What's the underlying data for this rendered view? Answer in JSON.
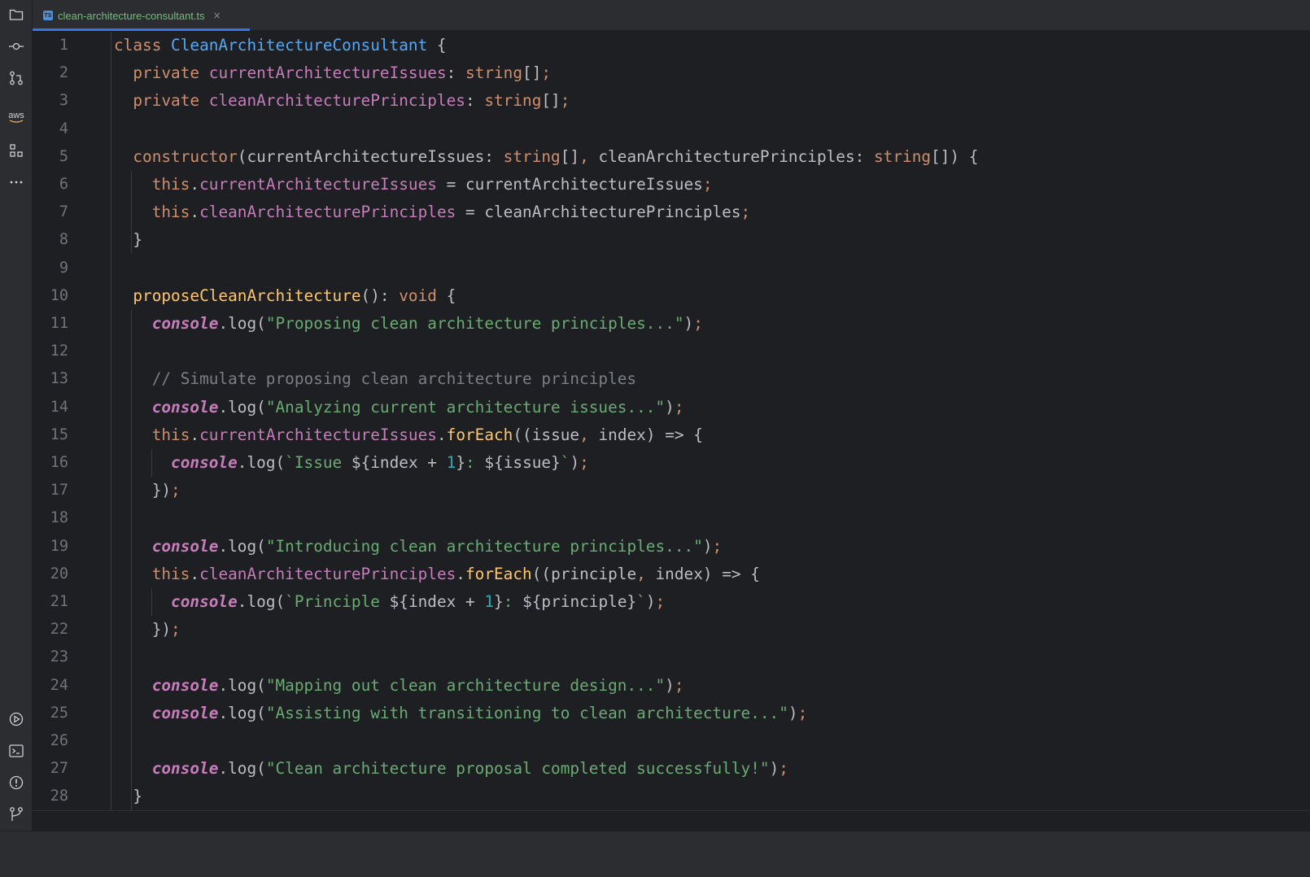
{
  "sidebar": {
    "top_icons": [
      "folder-icon",
      "commit-icon",
      "pull-requests-icon",
      "aws-icon",
      "structure-icon",
      "more-icon"
    ],
    "aws_label": "aws",
    "bottom_icons": [
      "run-icon",
      "terminal-icon",
      "problems-icon",
      "git-icon"
    ]
  },
  "tab": {
    "badge": "TS",
    "title": "clean-architecture-consultant.ts",
    "close": "×"
  },
  "editor": {
    "line_numbers": [
      "1",
      "2",
      "3",
      "4",
      "5",
      "6",
      "7",
      "8",
      "9",
      "10",
      "11",
      "12",
      "13",
      "14",
      "15",
      "16",
      "17",
      "18",
      "19",
      "20",
      "21",
      "22",
      "23",
      "24",
      "25",
      "26",
      "27",
      "28"
    ],
    "colors": {
      "keyword": "#cf8e6d",
      "class_name": "#56a8f5",
      "property": "#c77dbb",
      "function": "#ffc66d",
      "string": "#6aab73",
      "number": "#2aacb8",
      "comment": "#7a7e85",
      "text": "#bcbec4"
    },
    "lines": [
      [
        [
          "kw",
          "class "
        ],
        [
          "cls",
          "CleanArchitectureConsultant"
        ],
        [
          "plain",
          " {"
        ]
      ],
      [
        [
          "plain",
          "  "
        ],
        [
          "kw",
          "private "
        ],
        [
          "decl",
          "currentArchitectureIssues"
        ],
        [
          "plain",
          ": "
        ],
        [
          "kw",
          "string"
        ],
        [
          "plain",
          "[]"
        ],
        [
          "punc",
          ";"
        ]
      ],
      [
        [
          "plain",
          "  "
        ],
        [
          "kw",
          "private "
        ],
        [
          "decl",
          "cleanArchitecturePrinciples"
        ],
        [
          "plain",
          ": "
        ],
        [
          "kw",
          "string"
        ],
        [
          "plain",
          "[]"
        ],
        [
          "punc",
          ";"
        ]
      ],
      [],
      [
        [
          "plain",
          "  "
        ],
        [
          "kw",
          "constructor"
        ],
        [
          "plain",
          "(currentArchitectureIssues: "
        ],
        [
          "kw",
          "string"
        ],
        [
          "plain",
          "[]"
        ],
        [
          "punc",
          ", "
        ],
        [
          "plain",
          "cleanArchitecturePrinciples: "
        ],
        [
          "kw",
          "string"
        ],
        [
          "plain",
          "[]) {"
        ]
      ],
      [
        [
          "plain",
          "    "
        ],
        [
          "kw",
          "this"
        ],
        [
          "plain",
          "."
        ],
        [
          "prop",
          "currentArchitectureIssues"
        ],
        [
          "plain",
          " = currentArchitectureIssues"
        ],
        [
          "punc",
          ";"
        ]
      ],
      [
        [
          "plain",
          "    "
        ],
        [
          "kw",
          "this"
        ],
        [
          "plain",
          "."
        ],
        [
          "prop",
          "cleanArchitecturePrinciples"
        ],
        [
          "plain",
          " = cleanArchitecturePrinciples"
        ],
        [
          "punc",
          ";"
        ]
      ],
      [
        [
          "plain",
          "  }"
        ]
      ],
      [],
      [
        [
          "plain",
          "  "
        ],
        [
          "fn",
          "proposeCleanArchitecture"
        ],
        [
          "plain",
          "(): "
        ],
        [
          "kw",
          "void"
        ],
        [
          "plain",
          " {"
        ]
      ],
      [
        [
          "plain",
          "    "
        ],
        [
          "obj",
          "console"
        ],
        [
          "plain",
          "."
        ],
        [
          "plain",
          "log("
        ],
        [
          "str",
          "\"Proposing clean architecture principles...\""
        ],
        [
          "plain",
          ")"
        ],
        [
          "punc",
          ";"
        ]
      ],
      [],
      [
        [
          "plain",
          "    "
        ],
        [
          "cmt",
          "// Simulate proposing clean architecture principles"
        ]
      ],
      [
        [
          "plain",
          "    "
        ],
        [
          "obj",
          "console"
        ],
        [
          "plain",
          "."
        ],
        [
          "plain",
          "log("
        ],
        [
          "str",
          "\"Analyzing current architecture issues...\""
        ],
        [
          "plain",
          ")"
        ],
        [
          "punc",
          ";"
        ]
      ],
      [
        [
          "plain",
          "    "
        ],
        [
          "kw",
          "this"
        ],
        [
          "plain",
          "."
        ],
        [
          "prop",
          "currentArchitectureIssues"
        ],
        [
          "plain",
          "."
        ],
        [
          "fn",
          "forEach"
        ],
        [
          "plain",
          "((issue"
        ],
        [
          "punc",
          ", "
        ],
        [
          "plain",
          "index) => {"
        ]
      ],
      [
        [
          "plain",
          "      "
        ],
        [
          "obj",
          "console"
        ],
        [
          "plain",
          "."
        ],
        [
          "plain",
          "log("
        ],
        [
          "str",
          "`Issue "
        ],
        [
          "plain",
          "${index + "
        ],
        [
          "num",
          "1"
        ],
        [
          "plain",
          "}"
        ],
        [
          "str",
          ": "
        ],
        [
          "plain",
          "${issue}"
        ],
        [
          "str",
          "`"
        ],
        [
          "plain",
          ")"
        ],
        [
          "punc",
          ";"
        ]
      ],
      [
        [
          "plain",
          "    })"
        ],
        [
          "punc",
          ";"
        ]
      ],
      [],
      [
        [
          "plain",
          "    "
        ],
        [
          "obj",
          "console"
        ],
        [
          "plain",
          "."
        ],
        [
          "plain",
          "log("
        ],
        [
          "str",
          "\"Introducing clean architecture principles...\""
        ],
        [
          "plain",
          ")"
        ],
        [
          "punc",
          ";"
        ]
      ],
      [
        [
          "plain",
          "    "
        ],
        [
          "kw",
          "this"
        ],
        [
          "plain",
          "."
        ],
        [
          "prop",
          "cleanArchitecturePrinciples"
        ],
        [
          "plain",
          "."
        ],
        [
          "fn",
          "forEach"
        ],
        [
          "plain",
          "((principle"
        ],
        [
          "punc",
          ", "
        ],
        [
          "plain",
          "index) => {"
        ]
      ],
      [
        [
          "plain",
          "      "
        ],
        [
          "obj",
          "console"
        ],
        [
          "plain",
          "."
        ],
        [
          "plain",
          "log("
        ],
        [
          "str",
          "`Principle "
        ],
        [
          "plain",
          "${index + "
        ],
        [
          "num",
          "1"
        ],
        [
          "plain",
          "}"
        ],
        [
          "str",
          ": "
        ],
        [
          "plain",
          "${principle}"
        ],
        [
          "str",
          "`"
        ],
        [
          "plain",
          ")"
        ],
        [
          "punc",
          ";"
        ]
      ],
      [
        [
          "plain",
          "    })"
        ],
        [
          "punc",
          ";"
        ]
      ],
      [],
      [
        [
          "plain",
          "    "
        ],
        [
          "obj",
          "console"
        ],
        [
          "plain",
          "."
        ],
        [
          "plain",
          "log("
        ],
        [
          "str",
          "\"Mapping out clean architecture design...\""
        ],
        [
          "plain",
          ")"
        ],
        [
          "punc",
          ";"
        ]
      ],
      [
        [
          "plain",
          "    "
        ],
        [
          "obj",
          "console"
        ],
        [
          "plain",
          "."
        ],
        [
          "plain",
          "log("
        ],
        [
          "str",
          "\"Assisting with transitioning to clean architecture...\""
        ],
        [
          "plain",
          ")"
        ],
        [
          "punc",
          ";"
        ]
      ],
      [],
      [
        [
          "plain",
          "    "
        ],
        [
          "obj",
          "console"
        ],
        [
          "plain",
          "."
        ],
        [
          "plain",
          "log("
        ],
        [
          "str",
          "\"Clean architecture proposal completed successfully!\""
        ],
        [
          "plain",
          ")"
        ],
        [
          "punc",
          ";"
        ]
      ],
      [
        [
          "plain",
          "  }"
        ]
      ]
    ]
  }
}
